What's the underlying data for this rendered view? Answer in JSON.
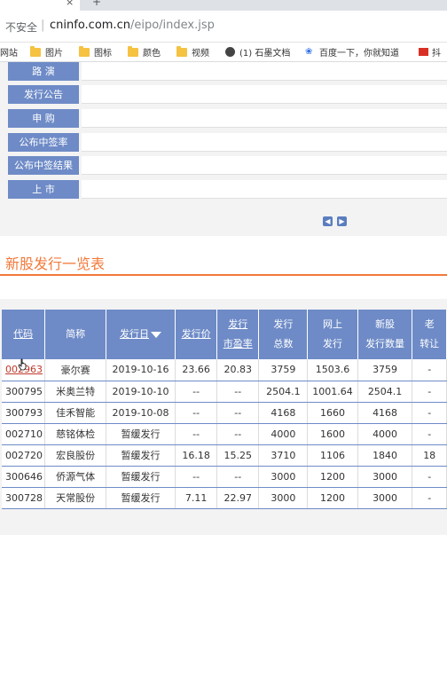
{
  "browser": {
    "security_label": "不安全",
    "url_host": "cninfo.com.cn",
    "url_path": "/eipo/index.jsp",
    "tab_close": "×",
    "new_tab": "+"
  },
  "bookmarks": [
    {
      "label": "网站",
      "icon": "none"
    },
    {
      "label": "图片",
      "icon": "folder-icon"
    },
    {
      "label": "图标",
      "icon": "folder-icon"
    },
    {
      "label": "颜色",
      "icon": "folder-icon"
    },
    {
      "label": "视频",
      "icon": "folder-icon"
    },
    {
      "label": "(1) 石墨文档",
      "icon": "shimo-icon"
    },
    {
      "label": "百度一下，你就知道",
      "icon": "baidu-icon"
    },
    {
      "label": "抖",
      "icon": "red-icon"
    }
  ],
  "steps": [
    "路 演",
    "发行公告",
    "申 购",
    "公布中签率",
    "公布中签结果",
    "上 市"
  ],
  "section_title": "新股发行一览表",
  "table": {
    "headers": [
      {
        "line1": "代码",
        "line2": "",
        "link": true
      },
      {
        "line1": "简称",
        "line2": "",
        "link": false
      },
      {
        "line1": "发行日",
        "line2": "",
        "link": true,
        "sort": true
      },
      {
        "line1": "发行价",
        "line2": "",
        "link": true
      },
      {
        "line1": "发行",
        "line2": "市盈率",
        "link": true
      },
      {
        "line1": "发行",
        "line2": "总数",
        "link": false
      },
      {
        "line1": "网上",
        "line2": "发行",
        "link": false
      },
      {
        "line1": "新股",
        "line2": "发行数量",
        "link": false
      },
      {
        "line1": "老",
        "line2": "转让",
        "link": false
      }
    ],
    "rows": [
      [
        "002963",
        "豪尔赛",
        "2019-10-16",
        "23.66",
        "20.83",
        "3759",
        "1503.6",
        "3759",
        "-"
      ],
      [
        "300795",
        "米奥兰特",
        "2019-10-10",
        "--",
        "--",
        "2504.1",
        "1001.64",
        "2504.1",
        "-"
      ],
      [
        "300793",
        "佳禾智能",
        "2019-10-08",
        "--",
        "--",
        "4168",
        "1660",
        "4168",
        "-"
      ],
      [
        "002710",
        "慈铭体检",
        "暂缓发行",
        "--",
        "--",
        "4000",
        "1600",
        "4000",
        "-"
      ],
      [
        "002720",
        "宏良股份",
        "暂缓发行",
        "16.18",
        "15.25",
        "3710",
        "1106",
        "1840",
        "18"
      ],
      [
        "300646",
        "侨源气体",
        "暂缓发行",
        "--",
        "--",
        "3000",
        "1200",
        "3000",
        "-"
      ],
      [
        "300728",
        "天常股份",
        "暂缓发行",
        "7.11",
        "22.97",
        "3000",
        "1200",
        "3000",
        "-"
      ]
    ]
  },
  "colors": {
    "header_blue": "#6e8bc7",
    "accent_orange": "#f2793a",
    "link_red": "#c0392b"
  }
}
